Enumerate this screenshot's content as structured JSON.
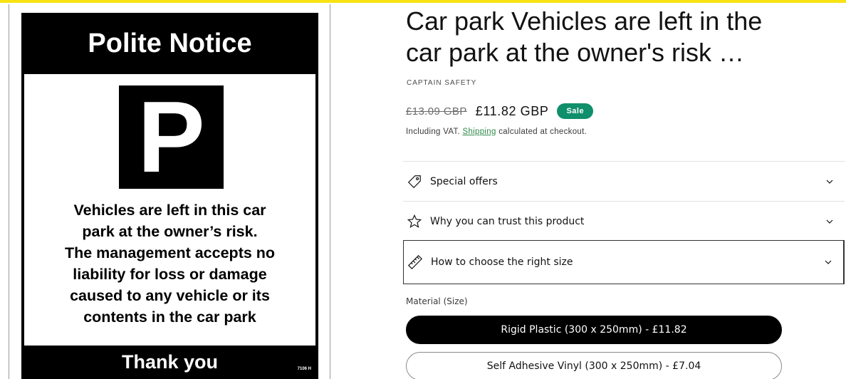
{
  "sign": {
    "heading": "Polite Notice",
    "symbol": "P",
    "lines": [
      "Vehicles are left in this car",
      "park at the owner’s risk.",
      "The management accepts no",
      "liability for loss or damage",
      "caused to any vehicle or its",
      "contents in the car park"
    ],
    "footer": "Thank you",
    "code": "7106 H"
  },
  "product": {
    "title_lines": [
      "Car park Vehicles are left in the",
      "car park at the owner's risk …"
    ],
    "vendor": "CAPTAIN SAFETY",
    "price_regular": "£13.09 GBP",
    "price_sale": "£11.82 GBP",
    "badge": "Sale",
    "tax_prefix": "Including VAT.",
    "tax_link": "Shipping",
    "tax_suffix": "calculated at checkout."
  },
  "accordions": [
    {
      "label": "Special offers",
      "icon": "tag-icon"
    },
    {
      "label": "Why you can trust this product",
      "icon": "star-icon"
    },
    {
      "label": "How to choose the right size",
      "icon": "ruler-icon"
    }
  ],
  "material": {
    "label": "Material (Size)",
    "options": [
      {
        "label": "Rigid Plastic (300 x 250mm) - £11.82",
        "selected": true
      },
      {
        "label": "Self Adhesive Vinyl (300 x 250mm) - £7.04",
        "selected": false
      }
    ]
  },
  "colors": {
    "sale_badge": "#0f8f6b",
    "link": "#2f8a4a",
    "highlight": "#f7e312"
  }
}
